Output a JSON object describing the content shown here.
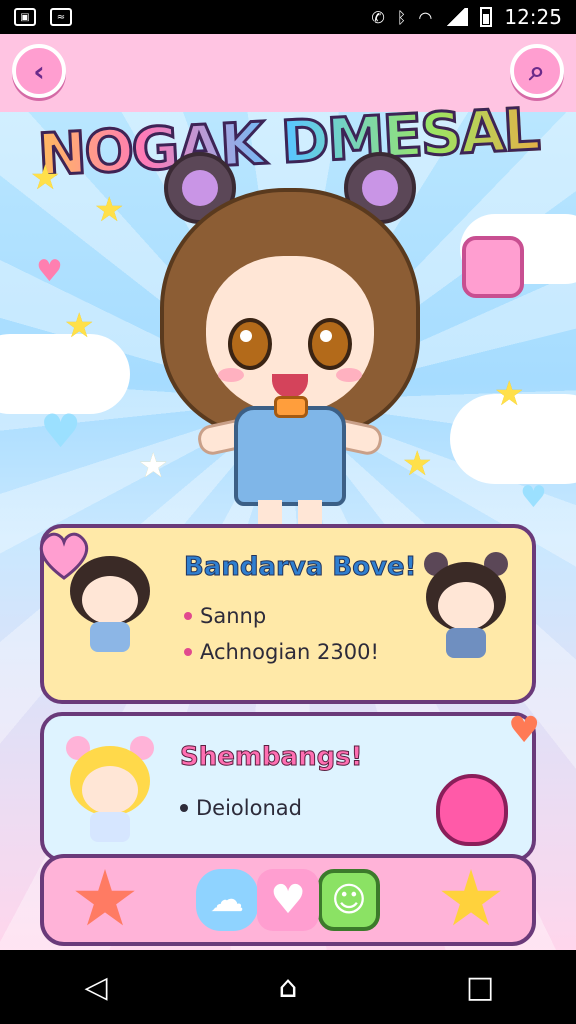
{
  "status_bar": {
    "left_icons": [
      "image-icon",
      "photo-icon"
    ],
    "right_icons": [
      "nfc-icon",
      "bluetooth-icon",
      "wifi-icon",
      "signal-icon",
      "battery-icon"
    ],
    "time": "12:25"
  },
  "header": {
    "title": "NOGAK DMESAL",
    "back_icon": "back-arrow-icon",
    "search_icon": "search-icon"
  },
  "card1": {
    "title": "Bandarva Bove!",
    "lines": [
      "Sannp",
      "Achnogian 2300!"
    ]
  },
  "card2": {
    "title": "Shembangs!",
    "lines": [
      "Deiolonad"
    ]
  },
  "dock": {
    "items": [
      "star-creature-icon",
      "cloud-creature-icon",
      "heart-icon",
      "gift-box-icon",
      "smile-star-icon"
    ]
  },
  "nav": {
    "items": [
      "back-triangle-icon",
      "home-icon",
      "recent-apps-icon"
    ]
  },
  "colors": {
    "accent_pink": "#ff9ed0",
    "accent_blue": "#8fd3ff",
    "card_yellow": "#ffe9a8",
    "card_blue": "#def3ff",
    "outline_purple": "#6a3a7a"
  }
}
